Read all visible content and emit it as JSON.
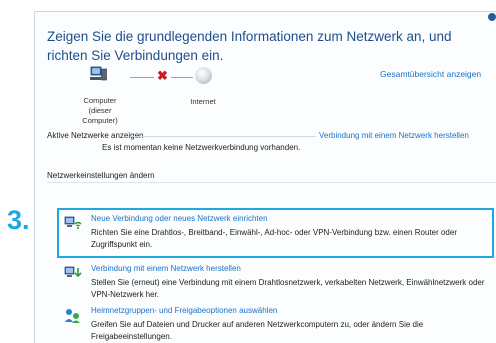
{
  "title": "Zeigen Sie die grundlegenden Informationen zum Netzwerk an, und richten Sie Verbindungen ein.",
  "overview_link": "Gesamtübersicht anzeigen",
  "map": {
    "computer_label_line1": "Computer",
    "computer_label_line2": "(dieser Computer)",
    "internet_label": "Internet"
  },
  "active_networks": {
    "label": "Aktive Netzwerke anzeigen",
    "connect_link": "Verbindung mit einem Netzwerk herstellen",
    "status": "Es ist momentan keine Netzwerkverbindung vorhanden."
  },
  "settings": {
    "heading": "Netzwerkeinstellungen ändern",
    "items": [
      {
        "link": "Neue Verbindung oder neues Netzwerk einrichten",
        "description": "Richten Sie eine Drahtlos-, Breitband-, Einwähl-, Ad-hoc- oder VPN-Verbindung bzw. einen Router oder Zugriffspunkt ein."
      },
      {
        "link": "Verbindung mit einem Netzwerk herstellen",
        "description": "Stellen Sie (erneut) eine Verbindung mit einem Drahtlosnetzwerk, verkabelten Netzwerk, Einwählnetzwerk oder VPN-Netzwerk her."
      },
      {
        "link": "Heimnetzgruppen- und Freigabeoptionen auswählen",
        "description": "Greifen Sie auf Dateien und Drucker auf anderen Netzwerkcomputern zu, oder ändern Sie die Freigabeeinstellungen."
      }
    ]
  },
  "step_marker": "3.",
  "colors": {
    "title": "#1f4e8c",
    "link": "#1a73c8",
    "highlight": "#1ea8df",
    "error_x": "#d21a1a"
  },
  "icons": [
    "computer-icon",
    "disconnected-x-icon",
    "internet-globe-icon",
    "new-connection-icon",
    "connect-network-icon",
    "homegroup-icon"
  ]
}
